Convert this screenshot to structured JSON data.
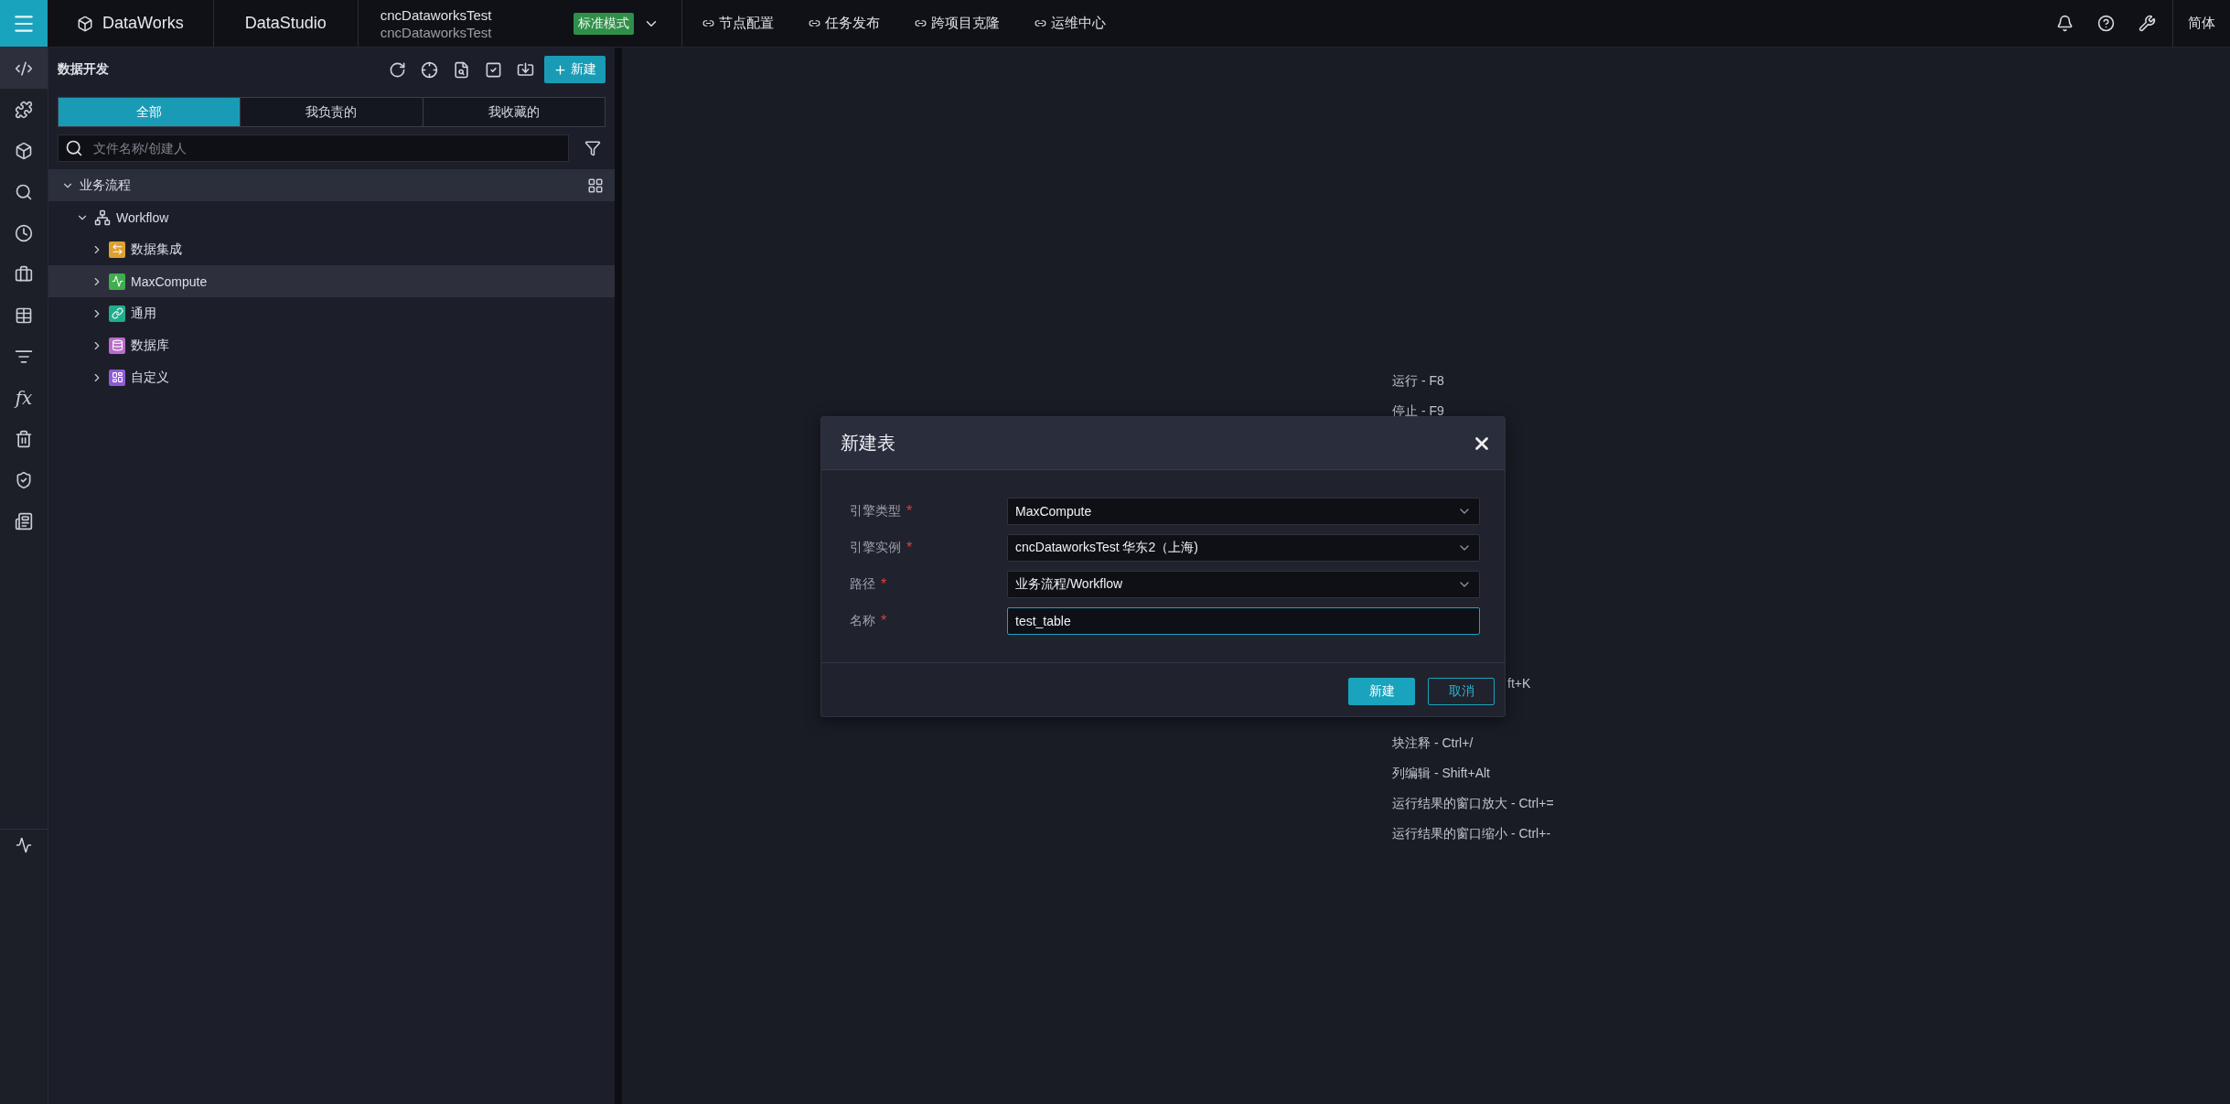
{
  "topbar": {
    "logo": "DataWorks",
    "app": "DataStudio",
    "project": {
      "name": "cncDataworksTest",
      "sub": "cncDataworksTest"
    },
    "mode_badge": "标准模式",
    "links": [
      "节点配置",
      "任务发布",
      "跨项目克隆",
      "运维中心"
    ],
    "language": "简体"
  },
  "rail": [
    {
      "selected": true
    },
    {
      "selected": false
    },
    {
      "selected": false
    },
    {
      "selected": false
    },
    {
      "selected": false
    },
    {
      "selected": false
    },
    {
      "selected": false
    },
    {
      "selected": false
    },
    {
      "selected": false,
      "label": "fx"
    },
    {
      "selected": false
    },
    {
      "selected": false
    },
    {
      "selected": false
    }
  ],
  "sidebar": {
    "title": "数据开发",
    "new_button": "新建",
    "tabs": [
      {
        "label": "全部",
        "selected": true
      },
      {
        "label": "我负责的",
        "selected": false
      },
      {
        "label": "我收藏的",
        "selected": false
      }
    ],
    "search": {
      "placeholder": "文件名称/创建人"
    },
    "tree": [
      {
        "label": "业务流程",
        "expanded": true,
        "children": [
          {
            "label": "Workflow",
            "expanded": true,
            "children": [
              {
                "label": "数据集成",
                "expanded": false,
                "selected": false,
                "color": "#e0a030"
              },
              {
                "label": "MaxCompute",
                "expanded": false,
                "selected": true,
                "color": "#3fae4f"
              },
              {
                "label": "通用",
                "expanded": false,
                "selected": false,
                "color": "#1fae8c"
              },
              {
                "label": "数据库",
                "expanded": false,
                "selected": false,
                "color": "#b86cc8"
              },
              {
                "label": "自定义",
                "expanded": false,
                "selected": false,
                "color": "#8e5bd8"
              }
            ]
          }
        ]
      }
    ]
  },
  "shortcuts": [
    {
      "text": "运行 - F8",
      "kind": "row"
    },
    {
      "text": "停止 - F9",
      "kind": "row"
    },
    {
      "text": "ft+K",
      "kind": "clipped"
    },
    {
      "text": "块注释 - Ctrl+/",
      "kind": "row"
    },
    {
      "text": "列编辑 - Shift+Alt",
      "kind": "row"
    },
    {
      "text": "运行结果的窗口放大 - Ctrl+=",
      "kind": "row"
    },
    {
      "text": "运行结果的窗口缩小 - Ctrl+-",
      "kind": "row"
    }
  ],
  "dialog": {
    "title": "新建表",
    "fields": [
      {
        "label": "引擎类型",
        "required_mark": "*",
        "kind": "select",
        "value": "MaxCompute",
        "focused": false
      },
      {
        "label": "引擎实例",
        "required_mark": "*",
        "kind": "select",
        "value": "cncDataworksTest 华东2（上海)",
        "focused": false
      },
      {
        "label": "路径",
        "required_mark": "*",
        "kind": "select",
        "value": "业务流程/Workflow",
        "focused": false
      },
      {
        "label": "名称",
        "required_mark": "*",
        "kind": "input",
        "value": "test_table",
        "focused": true
      }
    ],
    "buttons": [
      {
        "label": "新建",
        "kind": "primary"
      },
      {
        "label": "取消",
        "kind": "secondary"
      }
    ]
  }
}
